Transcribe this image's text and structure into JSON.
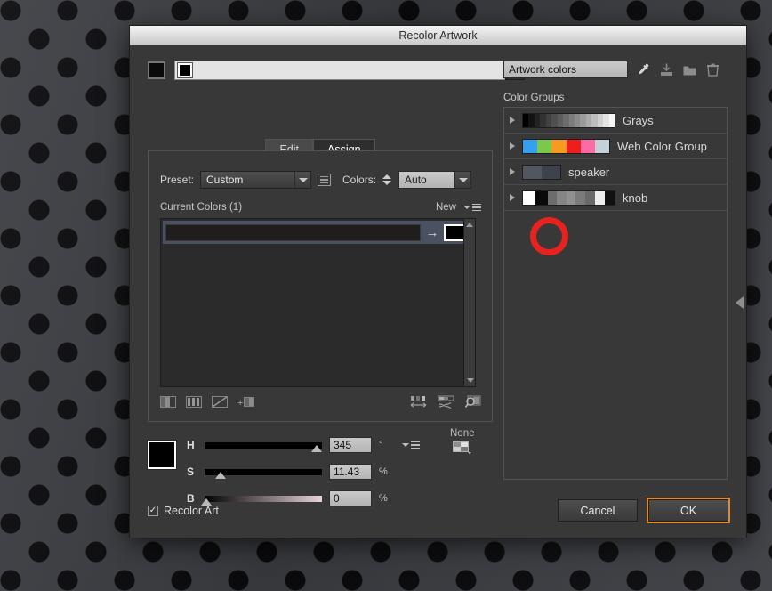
{
  "dialog": {
    "title": "Recolor Artwork"
  },
  "top": {
    "swatch_button_color": "#0a0a0a",
    "field_swatch_color": "#000000",
    "dropdown_icon": "chevron-down-icon"
  },
  "tabs": [
    {
      "label": "Edit",
      "active": false
    },
    {
      "label": "Assign",
      "active": true
    }
  ],
  "edit": {
    "preset_label": "Preset:",
    "preset_value": "Custom",
    "list_icon": "list-icon",
    "colors_label": "Colors:",
    "colors_value": "Auto",
    "current_colors_title": "Current Colors (1)",
    "new_label": "New",
    "panel_menu_icon": "panel-menu-icon",
    "rows": [
      {
        "current_color": "#201d1d",
        "new_color": "#000000",
        "arrow": "arrow-right-icon"
      }
    ],
    "toolbar_left": [
      "merge-colors-icon",
      "separate-colors-icon",
      "exclude-color-icon",
      "add-color-icon"
    ],
    "toolbar_right": [
      "randomize-order-icon",
      "randomize-brightness-icon",
      "color-reduction-icon"
    ]
  },
  "hsb": {
    "swatch_color": "#000000",
    "sliders": [
      {
        "label": "H",
        "value": "345",
        "unit": "°",
        "percent": 96
      },
      {
        "label": "S",
        "value": "11.43",
        "unit": "%",
        "percent": 11.43
      },
      {
        "label": "B",
        "value": "0",
        "unit": "%",
        "percent": 0
      }
    ],
    "menu_icon": "slider-menu-icon",
    "harmony_label": "None",
    "harmony_icon": "color-harmony-icon"
  },
  "right": {
    "artwork_colors_value": "Artwork colors",
    "tools": [
      "eyedropper-icon",
      "save-color-group-icon",
      "new-color-group-icon",
      "delete-color-group-icon"
    ],
    "color_groups_label": "Color Groups",
    "groups": [
      {
        "name": "Grays",
        "swatch_width": 105,
        "colors": [
          "#000000",
          "#131313",
          "#222222",
          "#333333",
          "#414141",
          "#4f4f4f",
          "#5e5e5e",
          "#6d6d6d",
          "#7c7c7c",
          "#8b8b8b",
          "#9b9b9b",
          "#ababab",
          "#bdbdbd",
          "#d0d0d0",
          "#e3e3e3",
          "#f6f6f6"
        ]
      },
      {
        "name": "Web Color Group",
        "swatch_width": 99,
        "colors": [
          "#35a0f0",
          "#7ac94a",
          "#f79a21",
          "#f01d1d",
          "#fc6ba5",
          "#c3d1d8"
        ]
      },
      {
        "name": "speaker",
        "swatch_width": 44,
        "colors": [
          "#52565f",
          "#3e424b"
        ]
      },
      {
        "name": "knob",
        "swatch_width": 105,
        "colors": [
          "#ffffff",
          "#0a0a0a",
          "#6d6d6d",
          "#858585",
          "#909090",
          "#7b7b7b",
          "#6a6a6a",
          "#eeeeee",
          "#111111"
        ]
      }
    ]
  },
  "footer": {
    "recolor_art_label": "Recolor Art",
    "recolor_art_checked": true,
    "check_glyph": "✓",
    "cancel_label": "Cancel",
    "ok_label": "OK"
  },
  "colors": {
    "accent": "#e08a2e",
    "annotation": "#e8231f",
    "panel_bg": "#383838"
  }
}
